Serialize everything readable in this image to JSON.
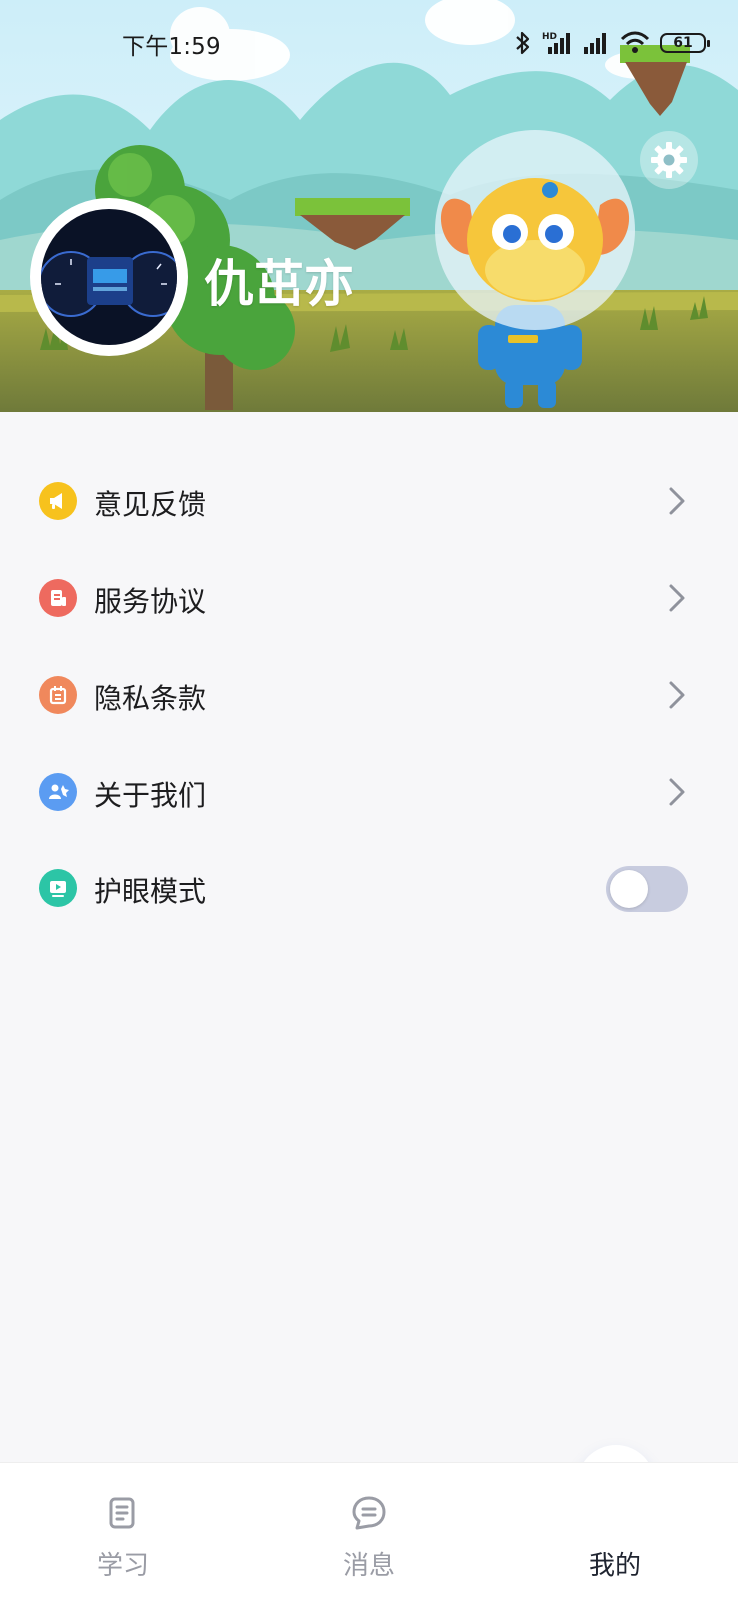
{
  "status_bar": {
    "time": "下午1:59",
    "battery": "61",
    "icons": [
      "bluetooth-icon",
      "hd-signal-icon",
      "signal-icon",
      "wifi-icon",
      "battery-icon"
    ]
  },
  "profile": {
    "username": "仇茁亦",
    "avatar": "dashboard-photo",
    "settings_icon": "gear-icon"
  },
  "menu": {
    "items": [
      {
        "label": "意见反馈",
        "icon": "megaphone-icon",
        "icon_color": "#f7c21d"
      },
      {
        "label": "服务协议",
        "icon": "document-icon",
        "icon_color": "#ee6a5f"
      },
      {
        "label": "隐私条款",
        "icon": "calendar-icon",
        "icon_color": "#f0885c"
      },
      {
        "label": "关于我们",
        "icon": "people-icon",
        "icon_color": "#5b9cf2"
      },
      {
        "label": "护眼模式",
        "icon": "screen-icon",
        "icon_color": "#2cc5a6",
        "toggle": false
      }
    ]
  },
  "tabbar": {
    "tabs": [
      {
        "label": "学习",
        "icon": "scroll-icon",
        "active": false
      },
      {
        "label": "消息",
        "icon": "chat-icon",
        "active": false
      },
      {
        "label": "我的",
        "icon": "user-icon",
        "active": true
      }
    ]
  },
  "colors": {
    "accent": "#4a78e0",
    "background": "#f7f7f9",
    "toggle_off": "#c8ccdf"
  }
}
